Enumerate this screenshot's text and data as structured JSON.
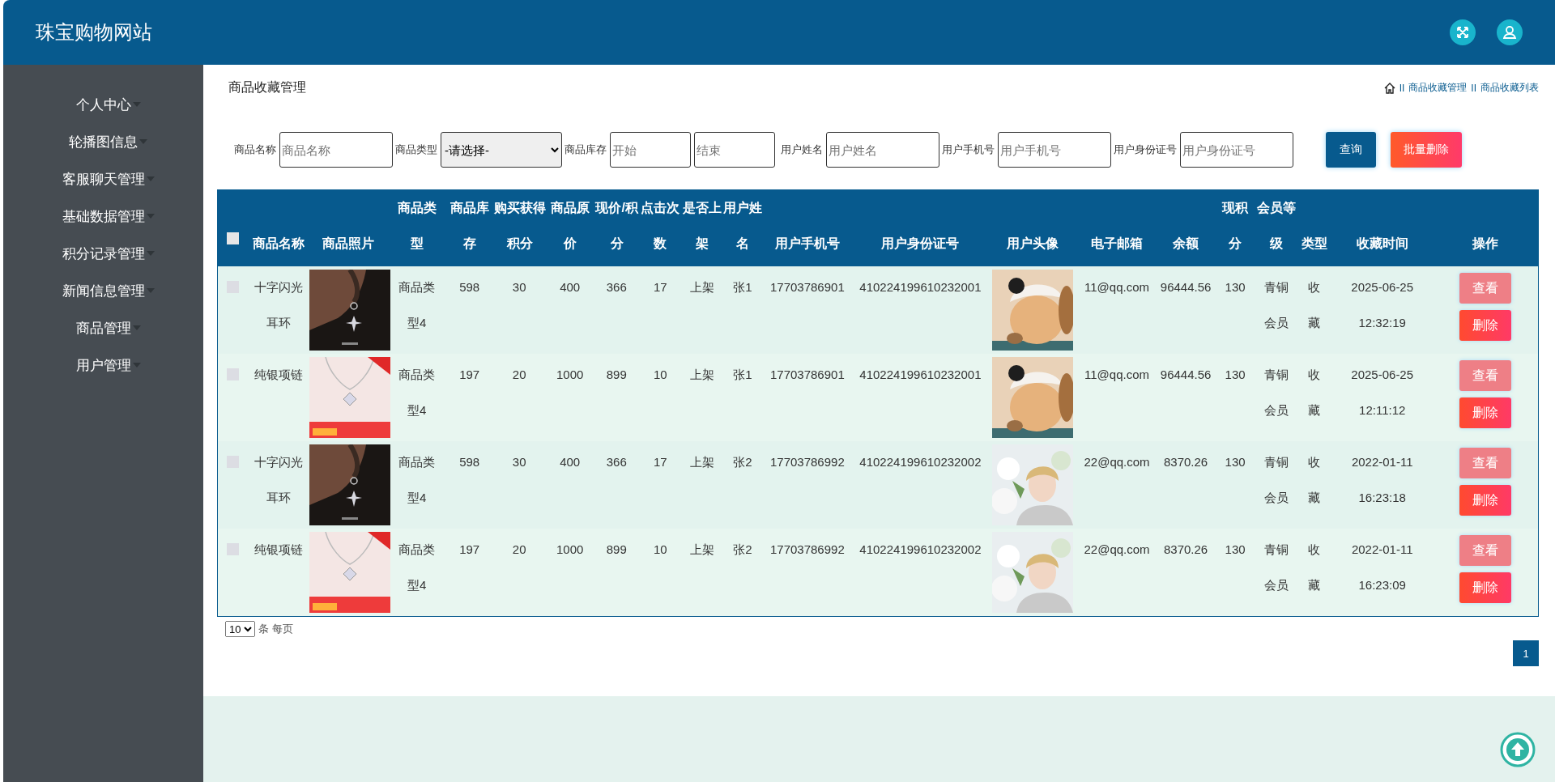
{
  "app": {
    "title": "珠宝购物网站"
  },
  "sidebar": {
    "items": [
      {
        "label": "个人中心"
      },
      {
        "label": "轮播图信息"
      },
      {
        "label": "客服聊天管理"
      },
      {
        "label": "基础数据管理"
      },
      {
        "label": "积分记录管理"
      },
      {
        "label": "新闻信息管理"
      },
      {
        "label": "商品管理"
      },
      {
        "label": "用户管理"
      }
    ]
  },
  "page_title": "商品收藏管理",
  "breadcrumb": [
    {
      "separator": "II",
      "label": "商品收藏管理"
    },
    {
      "separator": "II",
      "label": "商品收藏列表"
    }
  ],
  "search": {
    "fields": [
      {
        "kind": "text",
        "label": "商品名称",
        "placeholder": "商品名称"
      },
      {
        "kind": "select",
        "label": "商品类型",
        "value": "-请选择-"
      },
      {
        "kind": "range",
        "label": "商品库存",
        "placeholders": [
          "开始",
          "结束"
        ]
      },
      {
        "kind": "text",
        "label": "用户姓名",
        "placeholder": "用户姓名"
      },
      {
        "kind": "text",
        "label": "用户手机号",
        "placeholder": "用户手机号"
      },
      {
        "kind": "text",
        "label": "用户身份证号",
        "placeholder": "用户身份证号"
      }
    ],
    "buttons": [
      {
        "kind": "primary",
        "label": "查询"
      },
      {
        "kind": "danger",
        "label": "批量删除"
      }
    ]
  },
  "table": {
    "select_all": {
      "checked": false
    },
    "columns": [
      "商品名称",
      "商品照片",
      "商品类型",
      "商品库存",
      "购买获得积分",
      "商品原价",
      "现价/积分",
      "点击次数",
      "是否上架",
      "用户姓名",
      "用户手机号",
      "用户身份证号",
      "用户头像",
      "电子邮箱",
      "余额",
      "现积分",
      "会员等级",
      "类型",
      "收藏时间",
      "操作"
    ],
    "rows": [
      {
        "checked": false,
        "cells": [
          "十字闪光耳环",
          {
            "kind": "picture"
          },
          "商品类型4",
          "598",
          "30",
          "400",
          "366",
          "17",
          "上架",
          "张1",
          "17703786901",
          "410224199610232001",
          {
            "kind": "picture"
          },
          "11@qq.com",
          "96444.56",
          "130",
          "青铜会员",
          "收藏",
          "2025-06-25 12:32:19"
        ],
        "actions": [
          "查看",
          "删除"
        ]
      },
      {
        "checked": false,
        "cells": [
          "纯银项链",
          {
            "kind": "picture"
          },
          "商品类型4",
          "197",
          "20",
          "1000",
          "899",
          "10",
          "上架",
          "张1",
          "17703786901",
          "410224199610232001",
          {
            "kind": "picture"
          },
          "11@qq.com",
          "96444.56",
          "130",
          "青铜会员",
          "收藏",
          "2025-06-25 12:11:12"
        ],
        "actions": [
          "查看",
          "删除"
        ]
      },
      {
        "checked": false,
        "cells": [
          "十字闪光耳环",
          {
            "kind": "picture"
          },
          "商品类型4",
          "598",
          "30",
          "400",
          "366",
          "17",
          "上架",
          "张2",
          "17703786992",
          "410224199610232002",
          {
            "kind": "picture"
          },
          "22@qq.com",
          "8370.26",
          "130",
          "青铜会员",
          "收藏",
          "2022-01-11 16:23:18"
        ],
        "actions": [
          "查看",
          "删除"
        ]
      },
      {
        "checked": false,
        "cells": [
          "纯银项链",
          {
            "kind": "picture"
          },
          "商品类型4",
          "197",
          "20",
          "1000",
          "899",
          "10",
          "上架",
          "张2",
          "17703786992",
          "410224199610232002",
          {
            "kind": "picture"
          },
          "22@qq.com",
          "8370.26",
          "130",
          "青铜会员",
          "收藏",
          "2022-01-11 16:23:09"
        ],
        "actions": [
          "查看",
          "删除"
        ]
      }
    ]
  },
  "pagination": {
    "page_size": "10",
    "page_size_suffix": "条 每页",
    "pages": [
      {
        "label": "1",
        "selected": true
      }
    ]
  }
}
